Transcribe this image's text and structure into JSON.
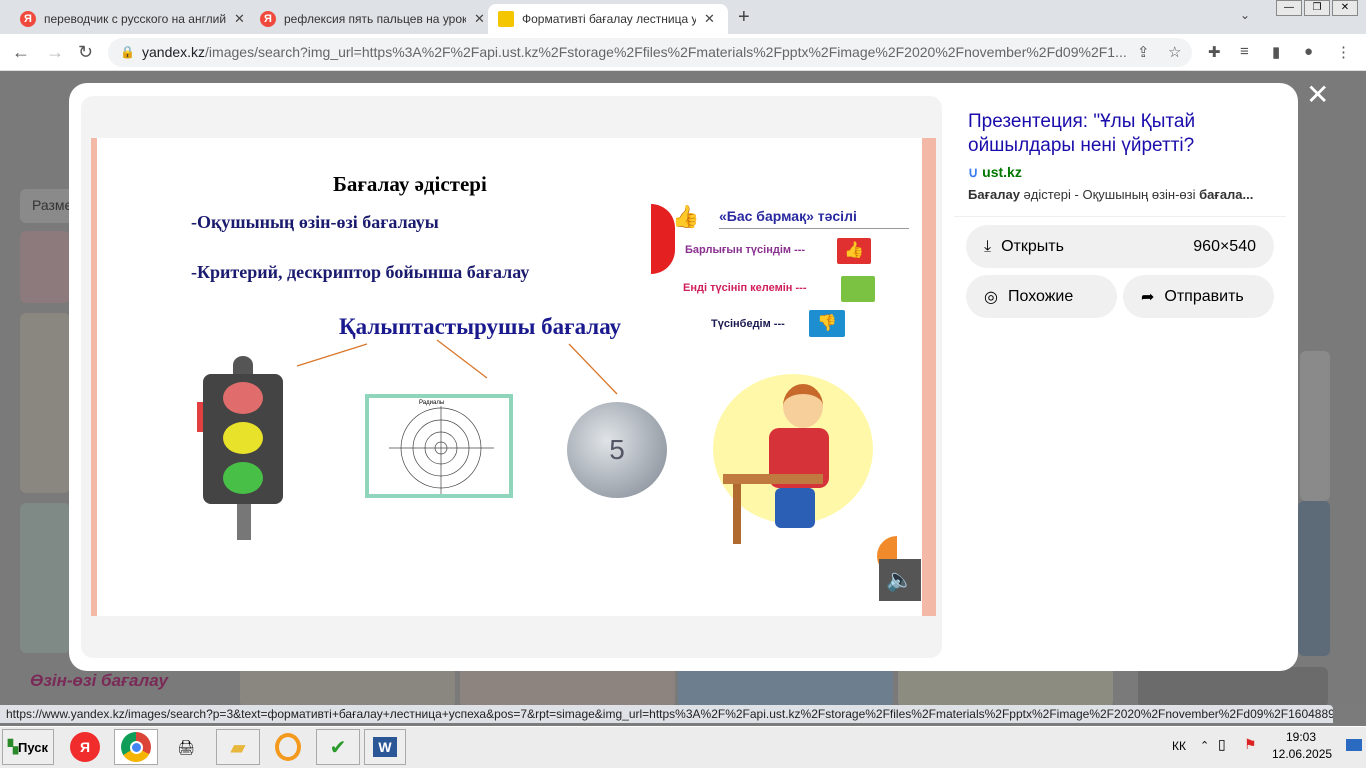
{
  "browser": {
    "tabs": [
      {
        "title": "переводчик с русского на английский",
        "active": false
      },
      {
        "title": "рефлексия пять пальцев на уроке",
        "active": false
      },
      {
        "title": "Формативті бағалау лестница успеха",
        "active": true
      }
    ],
    "url_host": "yandex.kz",
    "url_rest": "/images/search?img_url=https%3A%2F%2Fapi.ust.kz%2Fstorage%2Ffiles%2Fmaterials%2Fpptx%2Fimage%2F2020%2Fnovember%2Fd09%2F1..."
  },
  "background": {
    "filter_label": "Разме",
    "thumb_title": "Өзін-өзі бағалау"
  },
  "slide": {
    "title": "Бағалау әдістері",
    "line1": "-Оқушының өзін-өзі бағалауы",
    "line2": "-Критерий, дескриптор бойынша бағалау",
    "line3": "Қалыптастырушы бағалау",
    "method_title": "«Бас бармақ» тәсілі",
    "m1": "Барлығын түсіндім ---",
    "m2": "Енді түсініп келемін ---",
    "m3": "Түсінбедім ---",
    "target_title": "Радиалы"
  },
  "info": {
    "title": "Презентеция: \"Ұлы Қытай ойшылдары нені үйретті?",
    "source": "ust.kz",
    "desc_bold1": "Бағалау",
    "desc_mid": " әдістері - Оқушының өзін-өзі ",
    "desc_bold2": "бағала...",
    "open_label": "Открыть",
    "size": "960×540",
    "similar_label": "Похожие",
    "share_label": "Отправить"
  },
  "status_url": "https://www.yandex.kz/images/search?p=3&text=формативті+бағалау+лестница+успеха&pos=7&rpt=simage&img_url=https%3A%2F%2Fapi.ust.kz%2Fstorage%2Ffiles%2Fmaterials%2Fpptx%2Fimage%2F2020%2Fnovember%2Fd09%2F1604889104-6.jpeg&lr=21...",
  "taskbar": {
    "start": "Пуск",
    "lang": "КК",
    "time": "19:03",
    "date": "12.06.2025"
  }
}
